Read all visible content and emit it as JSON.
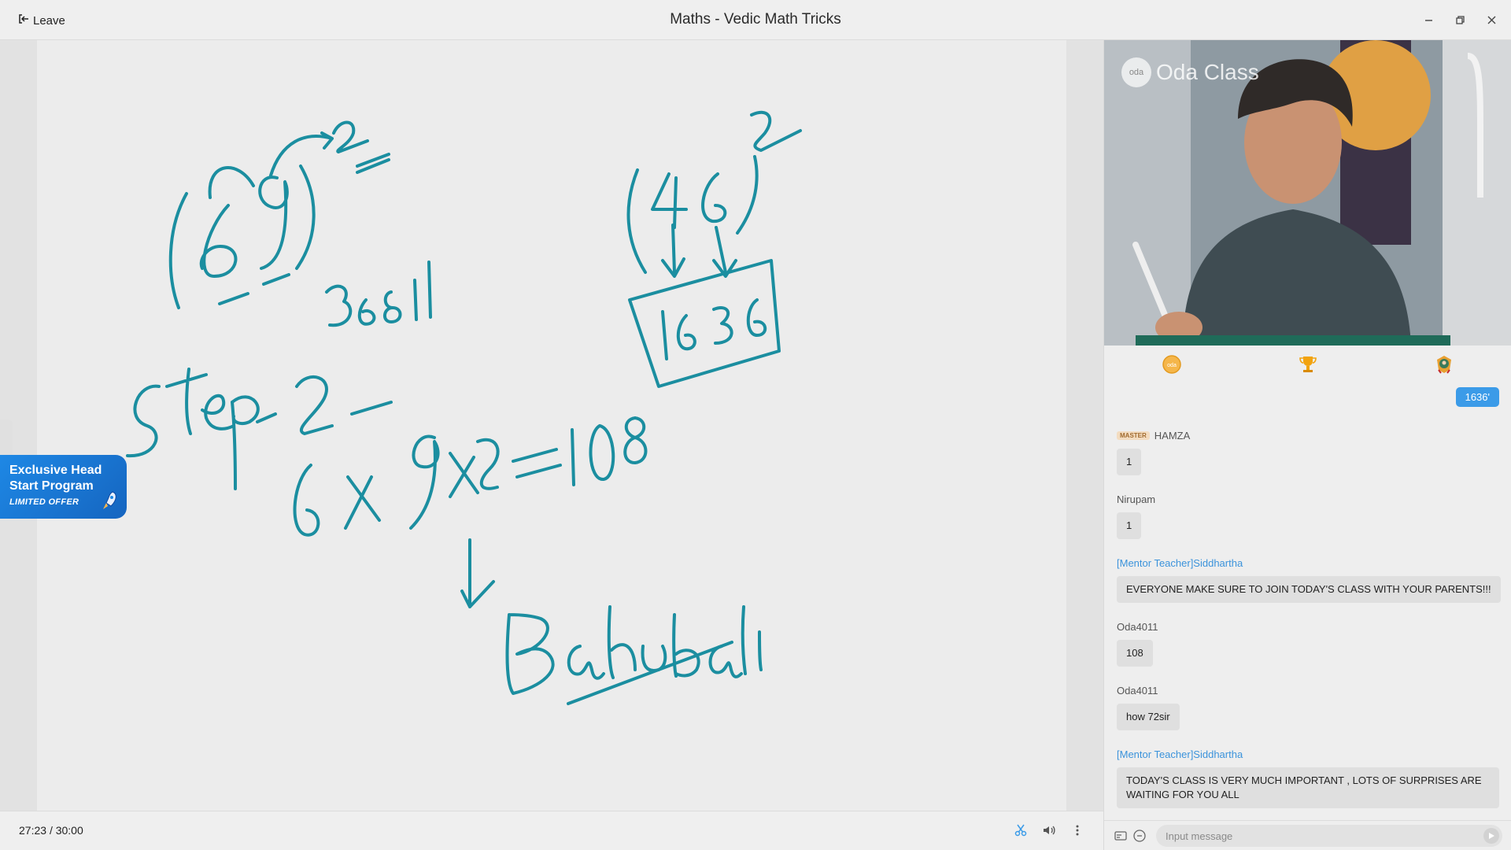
{
  "window": {
    "leave_label": "Leave",
    "title": "Maths - Vedic Math Tricks"
  },
  "board": {
    "handwriting": {
      "problem1": "(69)²",
      "result1": "3681",
      "problem2": "(46)²",
      "result2": "1636",
      "step": "Step - 2 -",
      "equation": "6 X 9X2 = 108",
      "word": "Bahubali"
    },
    "stroke_color": "#1b8ea0"
  },
  "promo": {
    "line1": "Exclusive Head",
    "line2": "Start Program",
    "tag": "LIMITED OFFER",
    "color": "#1e88e5"
  },
  "playback": {
    "current": "27:23",
    "separator": "/",
    "total": "30:00"
  },
  "video": {
    "brand": "Oda Class",
    "brand_dot": "oda"
  },
  "rewards": [
    {
      "icon": "coin-icon"
    },
    {
      "icon": "trophy-icon"
    },
    {
      "icon": "medal-icon"
    }
  ],
  "chat": {
    "my_last_message": "1636'",
    "messages": [
      {
        "sender": "HAMZA",
        "badge": "MASTER",
        "text": "1"
      },
      {
        "sender": "Nirupam",
        "text": "1"
      },
      {
        "sender": "[Mentor Teacher]Siddhartha",
        "mentor": true,
        "text": "EVERYONE MAKE SURE TO JOIN TODAY'S CLASS WITH YOUR PARENTS!!!"
      },
      {
        "sender": "Oda4011",
        "text": "108"
      },
      {
        "sender": "Oda4011",
        "text": "how 72sir"
      },
      {
        "sender": "[Mentor Teacher]Siddhartha",
        "mentor": true,
        "text": "TODAY'S  CLASS IS VERY MUCH IMPORTANT , LOTS OF SURPRISES ARE WAITING FOR YOU ALL"
      }
    ],
    "input_placeholder": "Input message"
  },
  "colors": {
    "accent": "#3b9be8",
    "mentor": "#3b93db"
  }
}
